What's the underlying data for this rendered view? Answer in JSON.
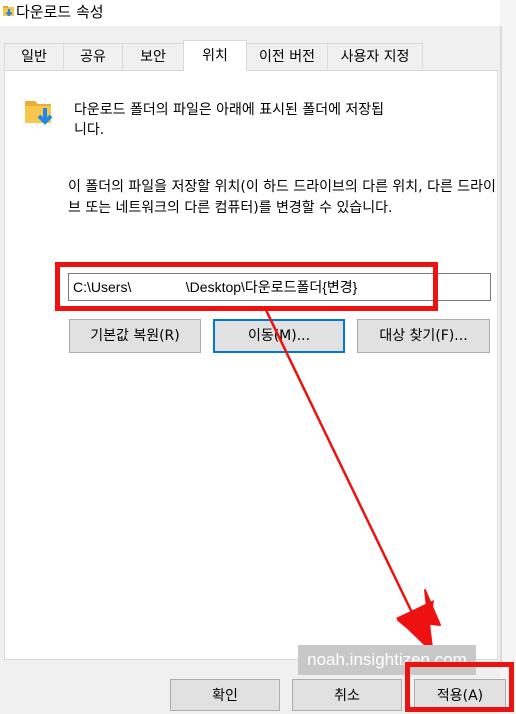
{
  "window": {
    "title": "다운로드 속성",
    "title_icon": "folder-download-icon"
  },
  "tabs": [
    {
      "label": "일반"
    },
    {
      "label": "공유"
    },
    {
      "label": "보안"
    },
    {
      "label": "위치",
      "active": true
    },
    {
      "label": "이전 버전"
    },
    {
      "label": "사용자 지정"
    }
  ],
  "location": {
    "folder_icon": "folder-download-icon",
    "description": "다운로드 폴더의 파일은 아래에 표시된 폴더에 저장됩\n니다.",
    "instruction": "이 폴더의 파일을 저장할 위치(이 하드 드라이브의 다른 위치, 다른 드라이브 또는 네트워크의 다른 컴퓨터)를 변경할 수 있습니다.",
    "path_value": "C:\\Users\\              \\Desktop\\다운로드폴더{변경}",
    "buttons": {
      "restore_default": "기본값 복원(R)",
      "move": "이동(M)...",
      "find_target": "대상 찾기(F)..."
    }
  },
  "watermark": "noah.insightizen.com",
  "footer": {
    "ok": "확인",
    "cancel": "취소",
    "apply": "적용(A)"
  },
  "colors": {
    "highlight": "#ee1111",
    "accent": "#0078d7",
    "folder": "#f8c64d",
    "download_arrow": "#1e88e5"
  }
}
